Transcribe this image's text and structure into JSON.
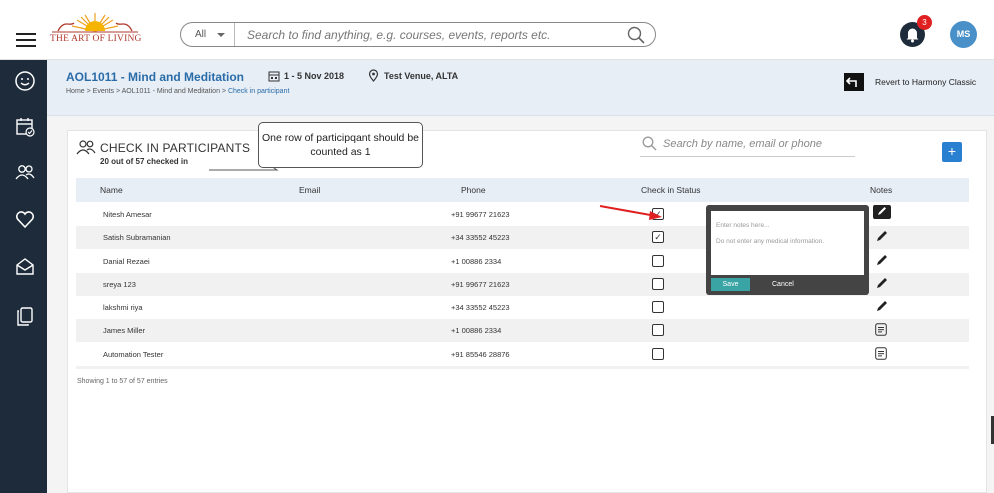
{
  "header": {
    "logo_text": "THE ART OF LIVING",
    "search_scope": "All",
    "search_placeholder": "Search to find anything, e.g. courses, events, reports etc.",
    "notification_count": "3",
    "user_initials": "MS",
    "colors": {
      "sidebar": "#1d2b3a",
      "accent": "#2a6ca8",
      "badge": "#e02020"
    }
  },
  "sidebar": {
    "items": [
      {
        "icon": "smiley-icon"
      },
      {
        "icon": "calendar-check-icon"
      },
      {
        "icon": "people-icon"
      },
      {
        "icon": "heart-icon"
      },
      {
        "icon": "mail-icon"
      },
      {
        "icon": "documents-icon"
      }
    ]
  },
  "event": {
    "title": "AOL1011 - Mind and Meditation",
    "date": "1 - 5 Nov 2018",
    "venue": "Test Venue, ALTA",
    "breadcrumb_path": "Home > Events > AOL1011 - Mind and Meditation > ",
    "breadcrumb_current": "Check in participant",
    "revert_label": "Revert to Harmony Classic"
  },
  "checkin": {
    "title": "CHECK IN PARTICIPANTS",
    "count": "20 out of 57 checked in",
    "callout": "One row of participqant should be counted as 1",
    "search_placeholder": "Search by name, email or phone",
    "add_label": "+",
    "columns": [
      "Name",
      "Email",
      "Phone",
      "Check in Status",
      "Notes"
    ],
    "rows": [
      {
        "name": "Nitesh Amesar",
        "email": "",
        "phone": "+91 99677 21623",
        "checked": true,
        "note": "edit-active"
      },
      {
        "name": "Satish Subramanian",
        "email": "",
        "phone": "+34 33552 45223",
        "checked": true,
        "note": "edit"
      },
      {
        "name": "Danial Rezaei",
        "email": "",
        "phone": "+1 00886 2334",
        "checked": false,
        "note": "edit"
      },
      {
        "name": "sreya 123",
        "email": "",
        "phone": "+91 99677 21623",
        "checked": false,
        "note": "edit"
      },
      {
        "name": "lakshmi riya",
        "email": "",
        "phone": "+34 33552 45223",
        "checked": false,
        "note": "edit"
      },
      {
        "name": "James Miller",
        "email": "",
        "phone": "+1 00886 2334",
        "checked": false,
        "note": "notes"
      },
      {
        "name": "Automation Tester",
        "email": "",
        "phone": "+91 85546 28876",
        "checked": false,
        "note": "notes"
      }
    ],
    "showing": "Showing 1 to 57 of 57 entries"
  },
  "notes_popup": {
    "placeholder": "Enter notes here...",
    "warning": "Do not enter any medical information.",
    "save_label": "Save",
    "cancel_label": "Cancel"
  }
}
